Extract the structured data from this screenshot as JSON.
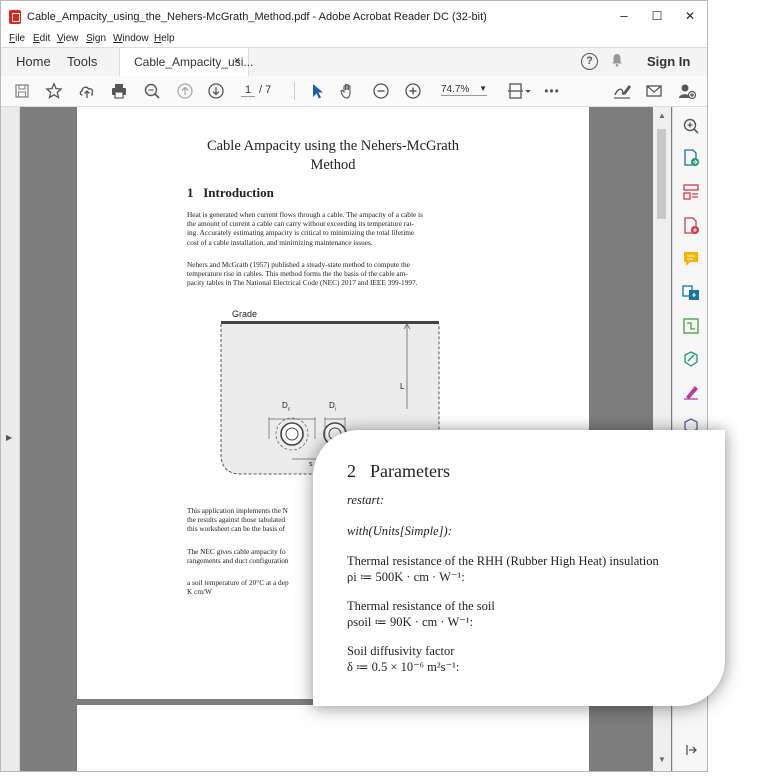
{
  "window": {
    "title": "Cable_Ampacity_using_the_Nehers-McGrath_Method.pdf - Adobe Acrobat Reader DC (32-bit)",
    "controls": {
      "minimize": "–",
      "maximize": "☐",
      "close": "✕"
    }
  },
  "menu": [
    "File",
    "Edit",
    "View",
    "Sign",
    "Window",
    "Help"
  ],
  "tabs": {
    "home": "Home",
    "tools": "Tools",
    "document": "Cable_Ampacity_usi...",
    "close": "×"
  },
  "header_right": {
    "help": "?",
    "sign_in": "Sign In"
  },
  "toolbar": {
    "page_current": "1",
    "page_total": "/ 7",
    "zoom": "74.7%",
    "more": "•••",
    "icons": [
      "save-icon",
      "star-icon",
      "upload-icon",
      "print-icon",
      "zoom-search-icon",
      "page-up-icon",
      "page-down-icon",
      "select-cursor-icon",
      "hand-icon",
      "zoom-out-icon",
      "zoom-in-icon",
      "fit-page-icon",
      "sign-icon",
      "email-icon",
      "add-user-icon"
    ]
  },
  "document": {
    "title_line1": "Cable Ampacity using the Nehers-McGrath",
    "title_line2": "Method",
    "section1_num": "1",
    "section1_title": "Introduction",
    "para1": [
      "Heat is generated when current flows through a cable. The ampacity of a cable is",
      "the amount of current a cable can carry without exceeding its temperature rat-",
      "ing. Accurately estimating ampacity is critical to minimizing the total lifetime",
      "cost of a cable installation, and minimizing maintenance issues."
    ],
    "para2": [
      "Nehers and McGrath (1957) published a steady-state method to compute the",
      "temperature rise in cables. This method forms the the basis of the cable am-",
      "pacity tables in The National Electrical Code (NEC) 2017 and IEEE 399-1997."
    ],
    "figure": {
      "grade": "Grade",
      "L": "L",
      "Dc": "D",
      "Dc_sub": "c",
      "Di": "D",
      "Di_sub": "i",
      "s": "s"
    },
    "para3": [
      "This application implements the N",
      "the results against those tabulated",
      "this worksheet can be the basis of"
    ],
    "para4": [
      "The NEC gives cable ampacity fo",
      "rangements and duct configuration"
    ],
    "para5": [
      "a soil temperature of 20°C at a dep",
      "K cm/W"
    ]
  },
  "popup": {
    "section_num": "2",
    "section_title": "Parameters",
    "cmd_restart": "restart:",
    "cmd_with": "with(Units[Simple]):",
    "rho_i_label": "Thermal resistance of the RHH (Rubber High Heat) insulation",
    "rho_i_expr": "ρi ≔ 500K · cm · W⁻¹:",
    "rho_soil_label": "Thermal resistance of the soil",
    "rho_soil_expr": "ρsoil ≔ 90K · cm · W⁻¹:",
    "delta_label": "Soil diffusivity factor",
    "delta_expr": "δ ≔ 0.5 × 10⁻⁶ m²s⁻¹:"
  },
  "colors": {
    "accent_red": "#e2231a",
    "doc_gray": "#7d7d7d",
    "toolbar_bg": "#fafafa"
  }
}
